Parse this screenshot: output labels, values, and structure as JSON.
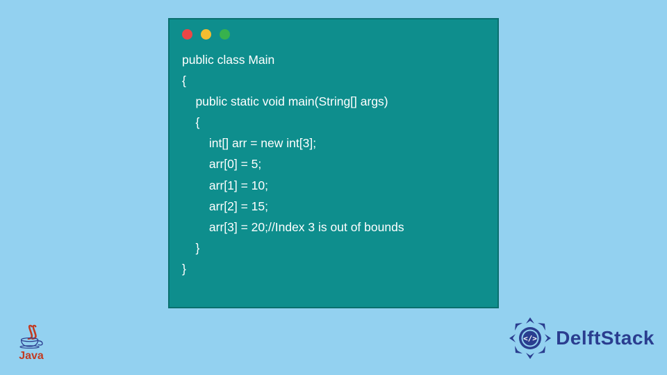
{
  "code": {
    "lines": [
      "public class Main",
      "{",
      "    public static void main(String[] args)",
      "    {",
      "        int[] arr = new int[3];",
      "        arr[0] = 5;",
      "        arr[1] = 10;",
      "        arr[2] = 15;",
      "        arr[3] = 20;//Index 3 is out of bounds",
      "    }",
      "}"
    ]
  },
  "logos": {
    "java_label": "Java",
    "delft_label": "DelftStack"
  },
  "colors": {
    "page_bg": "#93d1f0",
    "window_bg": "#0e8e8d",
    "code_text": "#ffffff",
    "dot_red": "#ec4646",
    "dot_yellow": "#f5bd30",
    "dot_green": "#37b24d",
    "java_accent": "#c23b22",
    "delft_accent": "#2a3d8f"
  }
}
